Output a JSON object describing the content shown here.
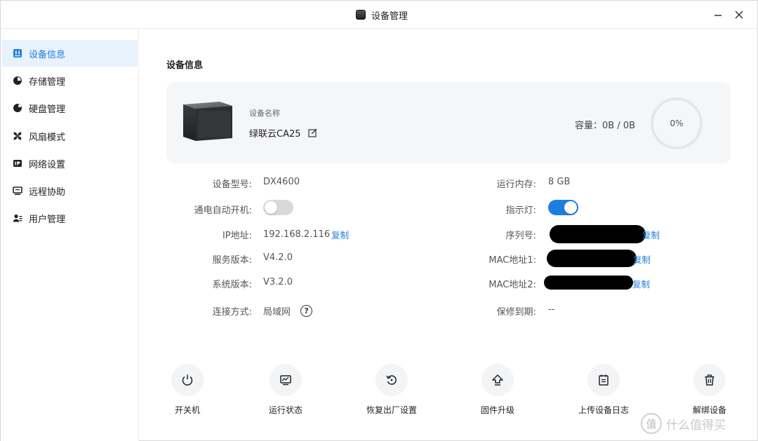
{
  "window": {
    "title": "设备管理"
  },
  "sidebar": {
    "items": [
      {
        "label": "设备信息",
        "icon": "device-info-icon"
      },
      {
        "label": "存储管理",
        "icon": "pie-chart-icon"
      },
      {
        "label": "硬盘管理",
        "icon": "disk-icon"
      },
      {
        "label": "风扇模式",
        "icon": "fan-icon"
      },
      {
        "label": "网络设置",
        "icon": "ip-icon"
      },
      {
        "label": "远程协助",
        "icon": "remote-screen-icon"
      },
      {
        "label": "用户管理",
        "icon": "users-icon"
      }
    ]
  },
  "main": {
    "section_title": "设备信息",
    "card": {
      "name_label": "设备名称",
      "name_value": "绿联云CA25",
      "capacity": "容量：0B / 0B",
      "usage_percent_text": "0%",
      "usage_fraction": 0
    },
    "left_info": [
      {
        "label": "设备型号:",
        "value": "DX4600"
      },
      {
        "label": "通电自动开机:",
        "toggle": false
      },
      {
        "label": "IP地址:",
        "value": "192.168.2.116",
        "link": "复制"
      },
      {
        "label": "服务版本:",
        "value": "V4.2.0"
      },
      {
        "label": "系统版本:",
        "value": "V3.2.0"
      },
      {
        "label": "连接方式:",
        "value": "局域网"
      }
    ],
    "right_info": [
      {
        "label": "运行内存:",
        "value": "8 GB"
      },
      {
        "label": "指示灯:",
        "toggle": true
      },
      {
        "label": "序列号:",
        "link": "复制"
      },
      {
        "label": "MAC地址1:",
        "link": "复制"
      },
      {
        "label": "MAC地址2:",
        "link": "复制"
      },
      {
        "label": "保修到期:",
        "value": "--"
      }
    ],
    "actions": [
      {
        "label": "开关机",
        "icon": "power-icon"
      },
      {
        "label": "运行状态",
        "icon": "monitor-icon"
      },
      {
        "label": "恢复出厂设置",
        "icon": "restore-icon"
      },
      {
        "label": "固件升级",
        "icon": "upgrade-icon"
      },
      {
        "label": "上传设备日志",
        "icon": "log-icon"
      },
      {
        "label": "解绑设备",
        "icon": "trash-icon"
      }
    ]
  },
  "watermark": {
    "symbol": "值",
    "text": "什么值得买"
  },
  "colors": {
    "accent": "#1e7ee0",
    "active_bg": "#e8f2fd",
    "card_bg": "#f5f6f8",
    "toggle_off": "#d9d9d9"
  }
}
